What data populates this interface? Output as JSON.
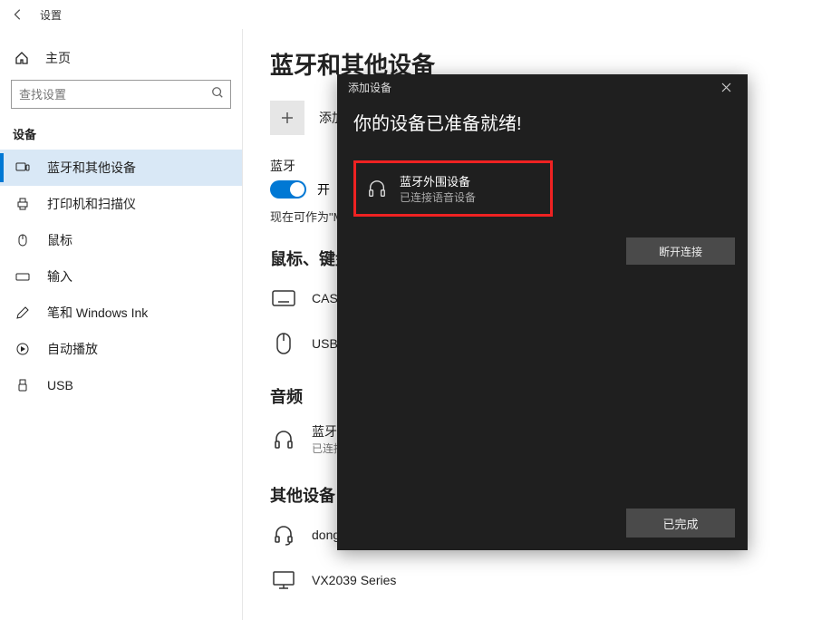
{
  "window": {
    "title": "设置"
  },
  "sidebar": {
    "home": "主页",
    "search_placeholder": "查找设置",
    "group": "设备",
    "items": [
      {
        "label": "蓝牙和其他设备"
      },
      {
        "label": "打印机和扫描仪"
      },
      {
        "label": "鼠标"
      },
      {
        "label": "输入"
      },
      {
        "label": "笔和 Windows Ink"
      },
      {
        "label": "自动播放"
      },
      {
        "label": "USB"
      }
    ]
  },
  "main": {
    "page_title": "蓝牙和其他设备",
    "add_label": "添加蓝牙",
    "bt_label": "蓝牙",
    "bt_state": "开",
    "discoverable": "现在可作为\"MKT",
    "sections": {
      "mkb": "鼠标、键盘和",
      "audio": "音频",
      "other": "其他设备"
    },
    "devices": {
      "kb": "CASUE U",
      "mouse": "USB OPT",
      "audio_name": "蓝牙外围",
      "audio_sub": "已连接的",
      "dongle": "dongle",
      "monitor": "VX2039 Series"
    }
  },
  "dialog": {
    "title": "添加设备",
    "heading": "你的设备已准备就绪!",
    "found_name": "蓝牙外围设备",
    "found_sub": "已连接语音设备",
    "disconnect": "断开连接",
    "done": "已完成"
  }
}
